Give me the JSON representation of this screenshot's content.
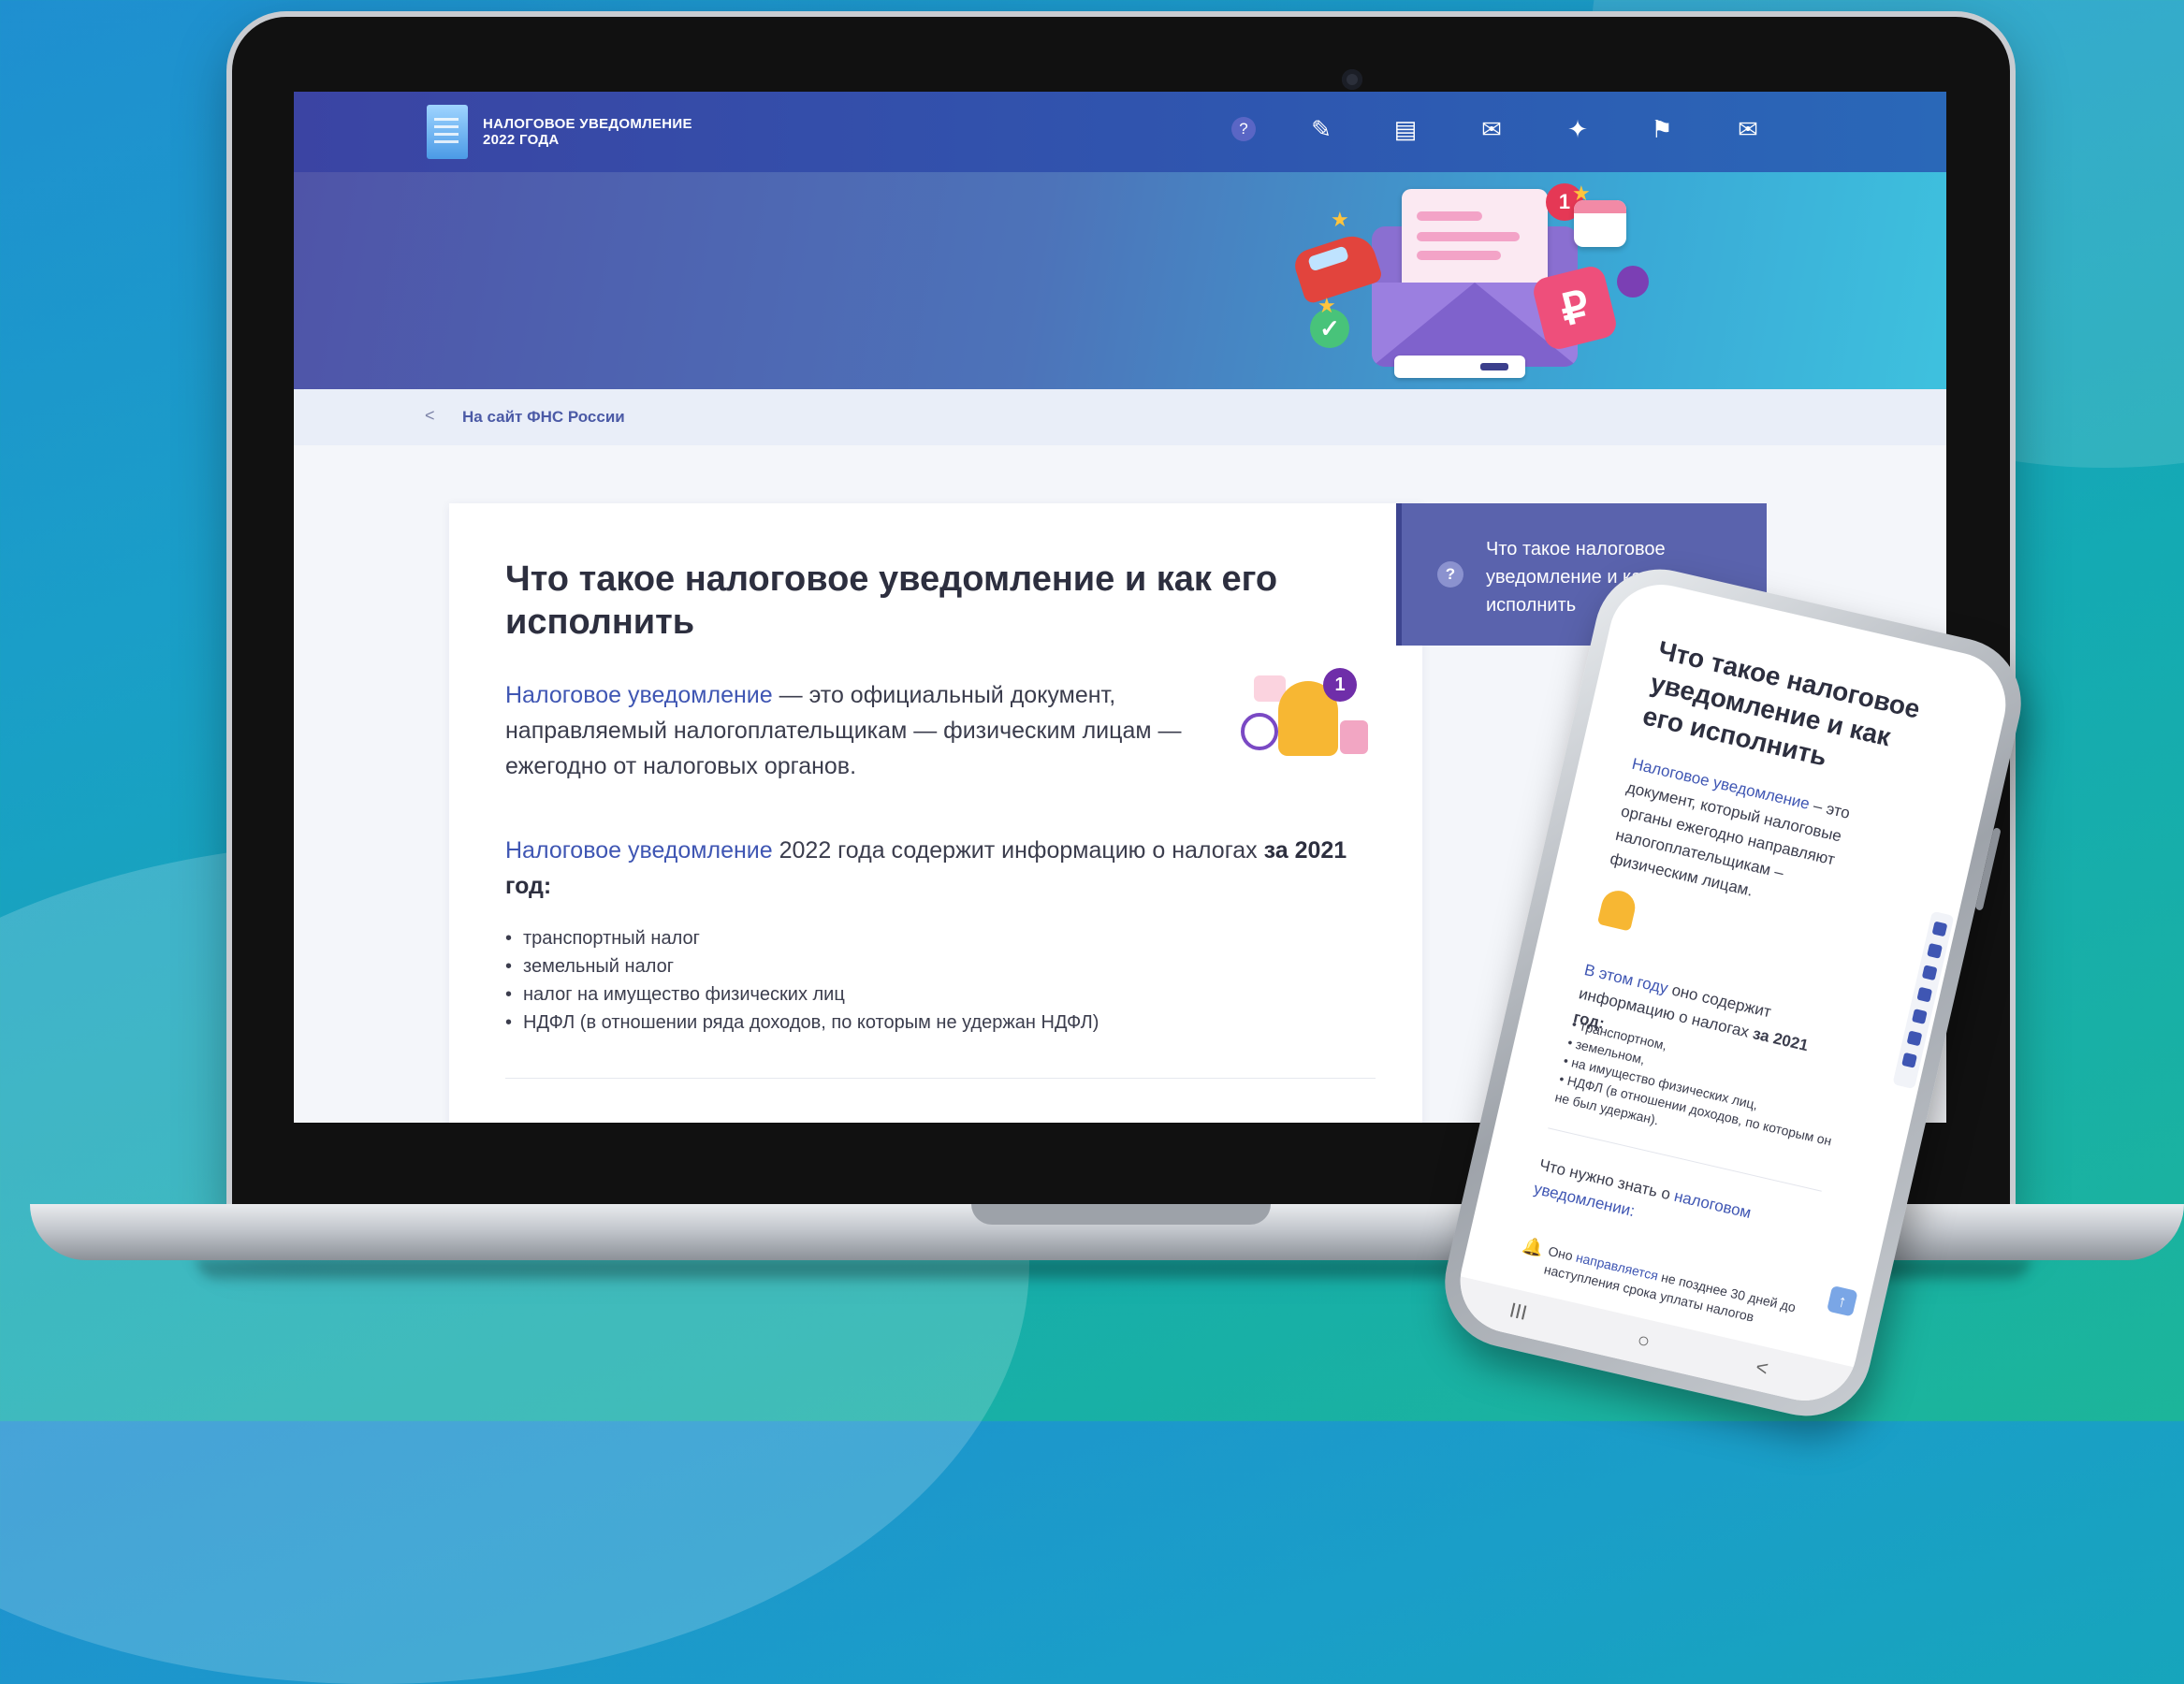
{
  "header": {
    "logo_line1": "НАЛОГОВОЕ УВЕДОМЛЕНИЕ",
    "logo_line2": "2022 ГОДА",
    "nav_icons": [
      "help-icon",
      "pencil-icon",
      "clipboard-icon",
      "envelope-icon",
      "pin-icon",
      "flag-icon",
      "mail-open-icon"
    ]
  },
  "breadcrumb": {
    "back_symbol": "<",
    "link_text": "На сайт ФНС России"
  },
  "article": {
    "title": "Что такое налоговое уведомление и как его исполнить",
    "lead_link": "Налоговое уведомление",
    "lead_rest": " — это официальный документ, направляемый налогоплательщикам — физическим лицам — ежегодно от налоговых органов.",
    "bell_badge": "1",
    "p2_link": "Налоговое уведомление",
    "p2_mid": " 2022 года содержит информацию о налогах ",
    "p2_bold": "за 2021 год:",
    "bullets": [
      "транспортный налог",
      "земельный налог",
      "налог на имущество физических лиц",
      "НДФЛ (в отношении ряда доходов, по которым не удержан НДФЛ)"
    ]
  },
  "side_panel": {
    "text": "Что такое налоговое уведомление и как его исполнить"
  },
  "hero": {
    "badge": "1",
    "ruble": "₽"
  },
  "phone": {
    "title": "Что такое налоговое уведомление и как его исполнить",
    "p1_link": "Налоговое уведомление",
    "p1_rest": " – это документ, который налоговые органы ежегодно направляют налогоплательщикам – физическим лицам.",
    "p2_link": "В этом году",
    "p2_mid": " оно содержит информацию о налогах ",
    "p2_bold": "за 2021 год:",
    "list": [
      "транспортном,",
      "земельном,",
      "на имущество физических лиц,",
      "НДФЛ (в отношении доходов, по которым он не был удержан)."
    ],
    "know_pre": "Что нужно знать о ",
    "know_link": "налоговом уведомлении:",
    "item_pre": "Оно ",
    "item_link": "направляется",
    "item_rest": " не позднее 30 дней до наступления срока уплаты налогов",
    "nav_back": "<",
    "nav_home": "○",
    "nav_menu": "III",
    "up": "↑"
  }
}
